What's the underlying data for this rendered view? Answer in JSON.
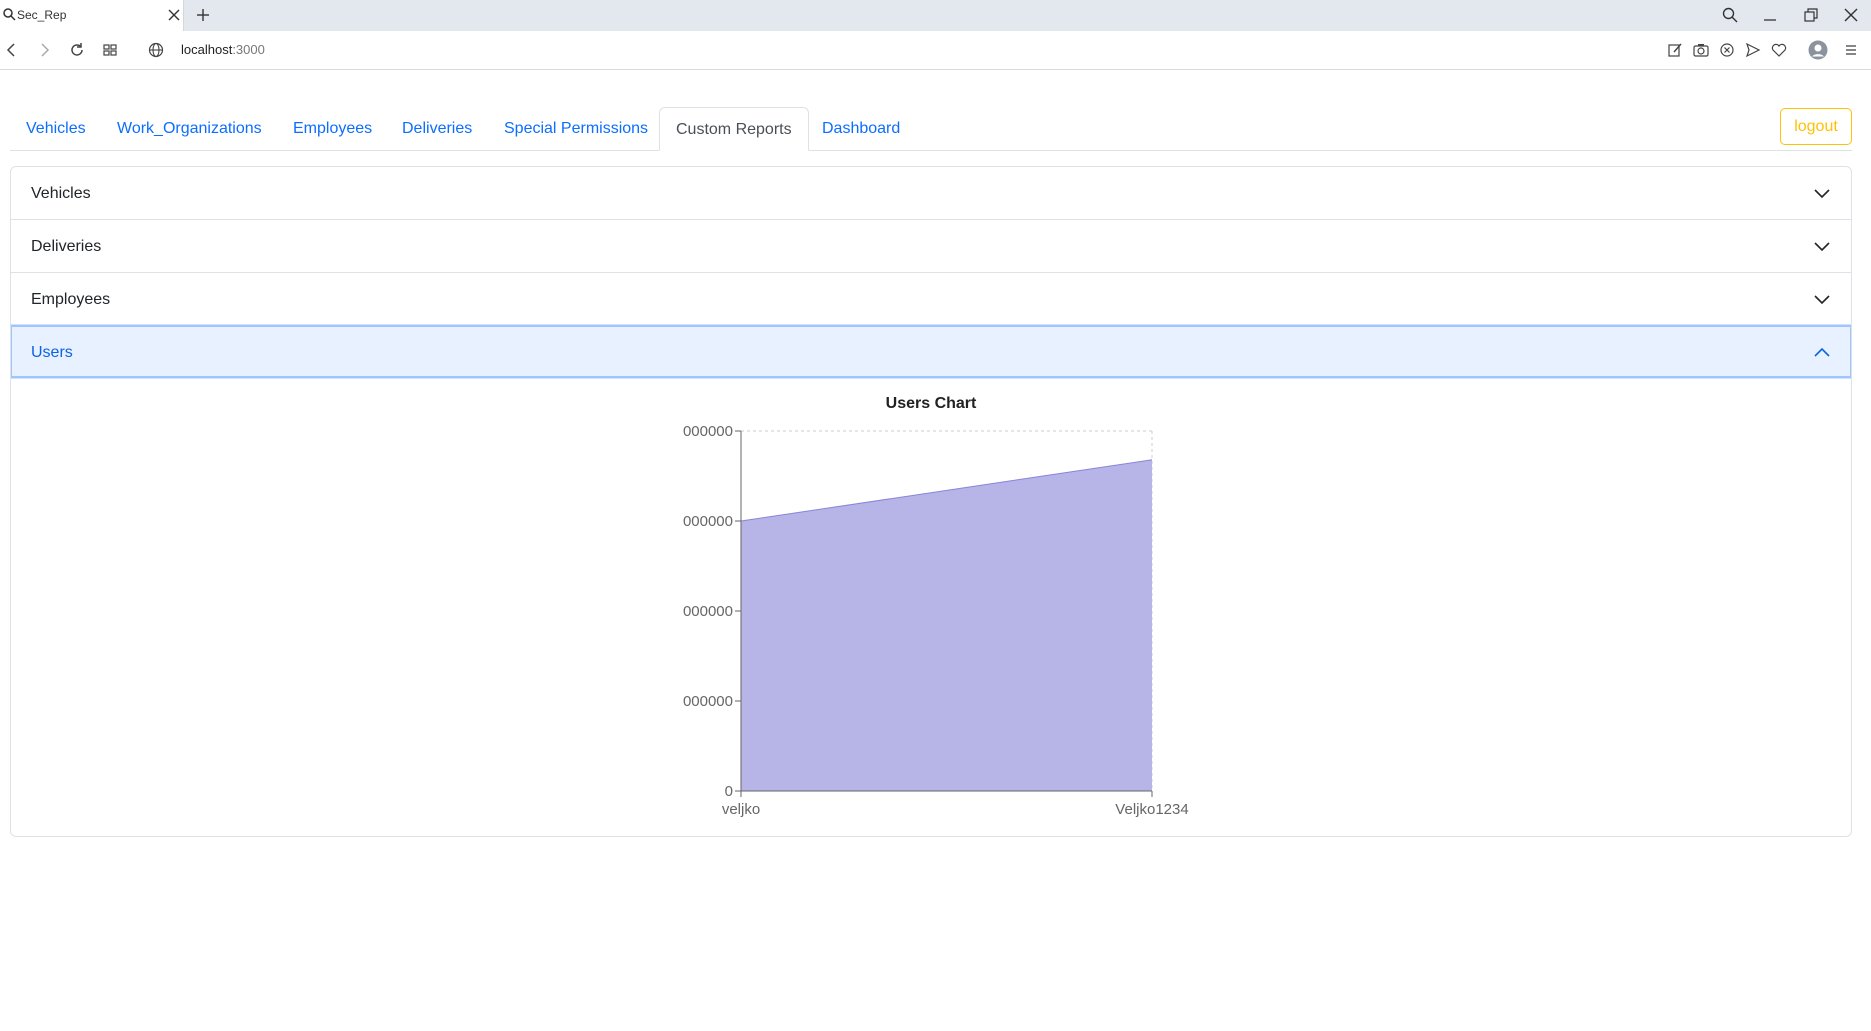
{
  "browser": {
    "tab_title": "Sec_Rep",
    "url_host": "localhost",
    "url_port": ":3000"
  },
  "nav": {
    "tabs": [
      {
        "label": "Vehicles",
        "active": false
      },
      {
        "label": "Work_Organizations",
        "active": false
      },
      {
        "label": "Employees",
        "active": false
      },
      {
        "label": "Deliveries",
        "active": false
      },
      {
        "label": "Special Permissions",
        "active": false
      },
      {
        "label": "Custom Reports",
        "active": true
      },
      {
        "label": "Dashboard",
        "active": false
      }
    ],
    "logout_label": "logout"
  },
  "accordion": {
    "sections": [
      {
        "label": "Vehicles",
        "open": false
      },
      {
        "label": "Deliveries",
        "open": false
      },
      {
        "label": "Employees",
        "open": false
      },
      {
        "label": "Users",
        "open": true
      }
    ]
  },
  "colors": {
    "link": "#0d6efd",
    "warning": "#ffc107",
    "area_fill": "#b7b4e8",
    "area_stroke": "#8884d8"
  },
  "chart_data": {
    "type": "area",
    "title": "Users Chart",
    "x": [
      "veljko",
      "Veljko1234"
    ],
    "series": [
      {
        "values": [
          3,
          3.68
        ]
      }
    ],
    "ylim": [
      0,
      4
    ],
    "ytick_labels": [
      "0",
      "000000",
      "000000",
      "000000",
      "000000"
    ],
    "grid": true
  }
}
